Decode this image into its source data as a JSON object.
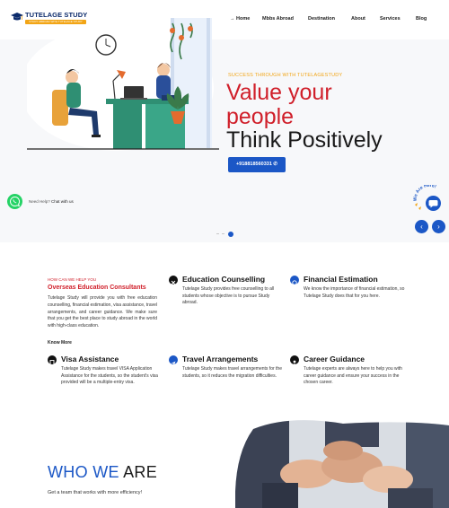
{
  "header": {
    "logo_text": "TUTELAGE STUDY",
    "logo_tagline": "STUDY ABROAD WITH TUTELAGE STUDY",
    "nav": [
      {
        "label": "→ Home"
      },
      {
        "label": "Mbbs Abroad"
      },
      {
        "label": "Destination"
      },
      {
        "label": "About"
      },
      {
        "label": "Services"
      },
      {
        "label": "Blog"
      }
    ]
  },
  "hero": {
    "kicker": "SUCCESS THROUGH WITH TUTELAGESTUDY",
    "line1": "Value your",
    "line2": "people",
    "line3": "Think Positively",
    "phone_button": "+918818560331 ✆",
    "whatsapp_prefix": "Need Help?",
    "whatsapp_label": "Chat with us",
    "chat_badge": "We Are Here!",
    "prev_arrow": "‹",
    "next_arrow": "›",
    "slide_index": 3,
    "slide_count": 3
  },
  "help": {
    "kicker": "HOW CAN WE HELP YOU",
    "title": "Overseas Education Consultants",
    "body": "Tutelage Study will provide you with free education counselling, financial estimation, visa assistance, travel arrangements, and career guidance. We make sure that you get the best place to study abroad in the world with high-class education.",
    "link": "Know More"
  },
  "services": [
    {
      "icon": "education-icon",
      "title": "Education Counselling",
      "desc": "Tutelage Study provides free counselling to all students whose objective is to pursue Study abroad."
    },
    {
      "icon": "financial-icon",
      "title": "Financial Estimation",
      "desc": "We know the importance of financial estimation, so Tutelage Study does that for you here."
    },
    {
      "icon": "visa-icon",
      "title": "Visa Assistance",
      "desc": "Tutelage Study makes travel VISA Application Assistance for the students, so the student's visa provided will be a multiple-entry visa."
    },
    {
      "icon": "travel-icon",
      "title": "Travel Arrangements",
      "desc": "Tutelage Study makes travel arrangements for the students, so it reduces the migration difficulties."
    },
    {
      "icon": "career-icon",
      "title": "Career Guidance",
      "desc": "Tutelage experts are always here to help you with career guidance and ensure your success in the chosen career."
    }
  ],
  "who": {
    "title_a": "WHO WE ",
    "title_b": "ARE",
    "subtitle": "Get a team that works with more efficiency!"
  },
  "colors": {
    "brand_blue": "#1b57c6",
    "brand_red": "#d01f2a",
    "accent_orange": "#f2a516",
    "whatsapp_green": "#25d366"
  }
}
